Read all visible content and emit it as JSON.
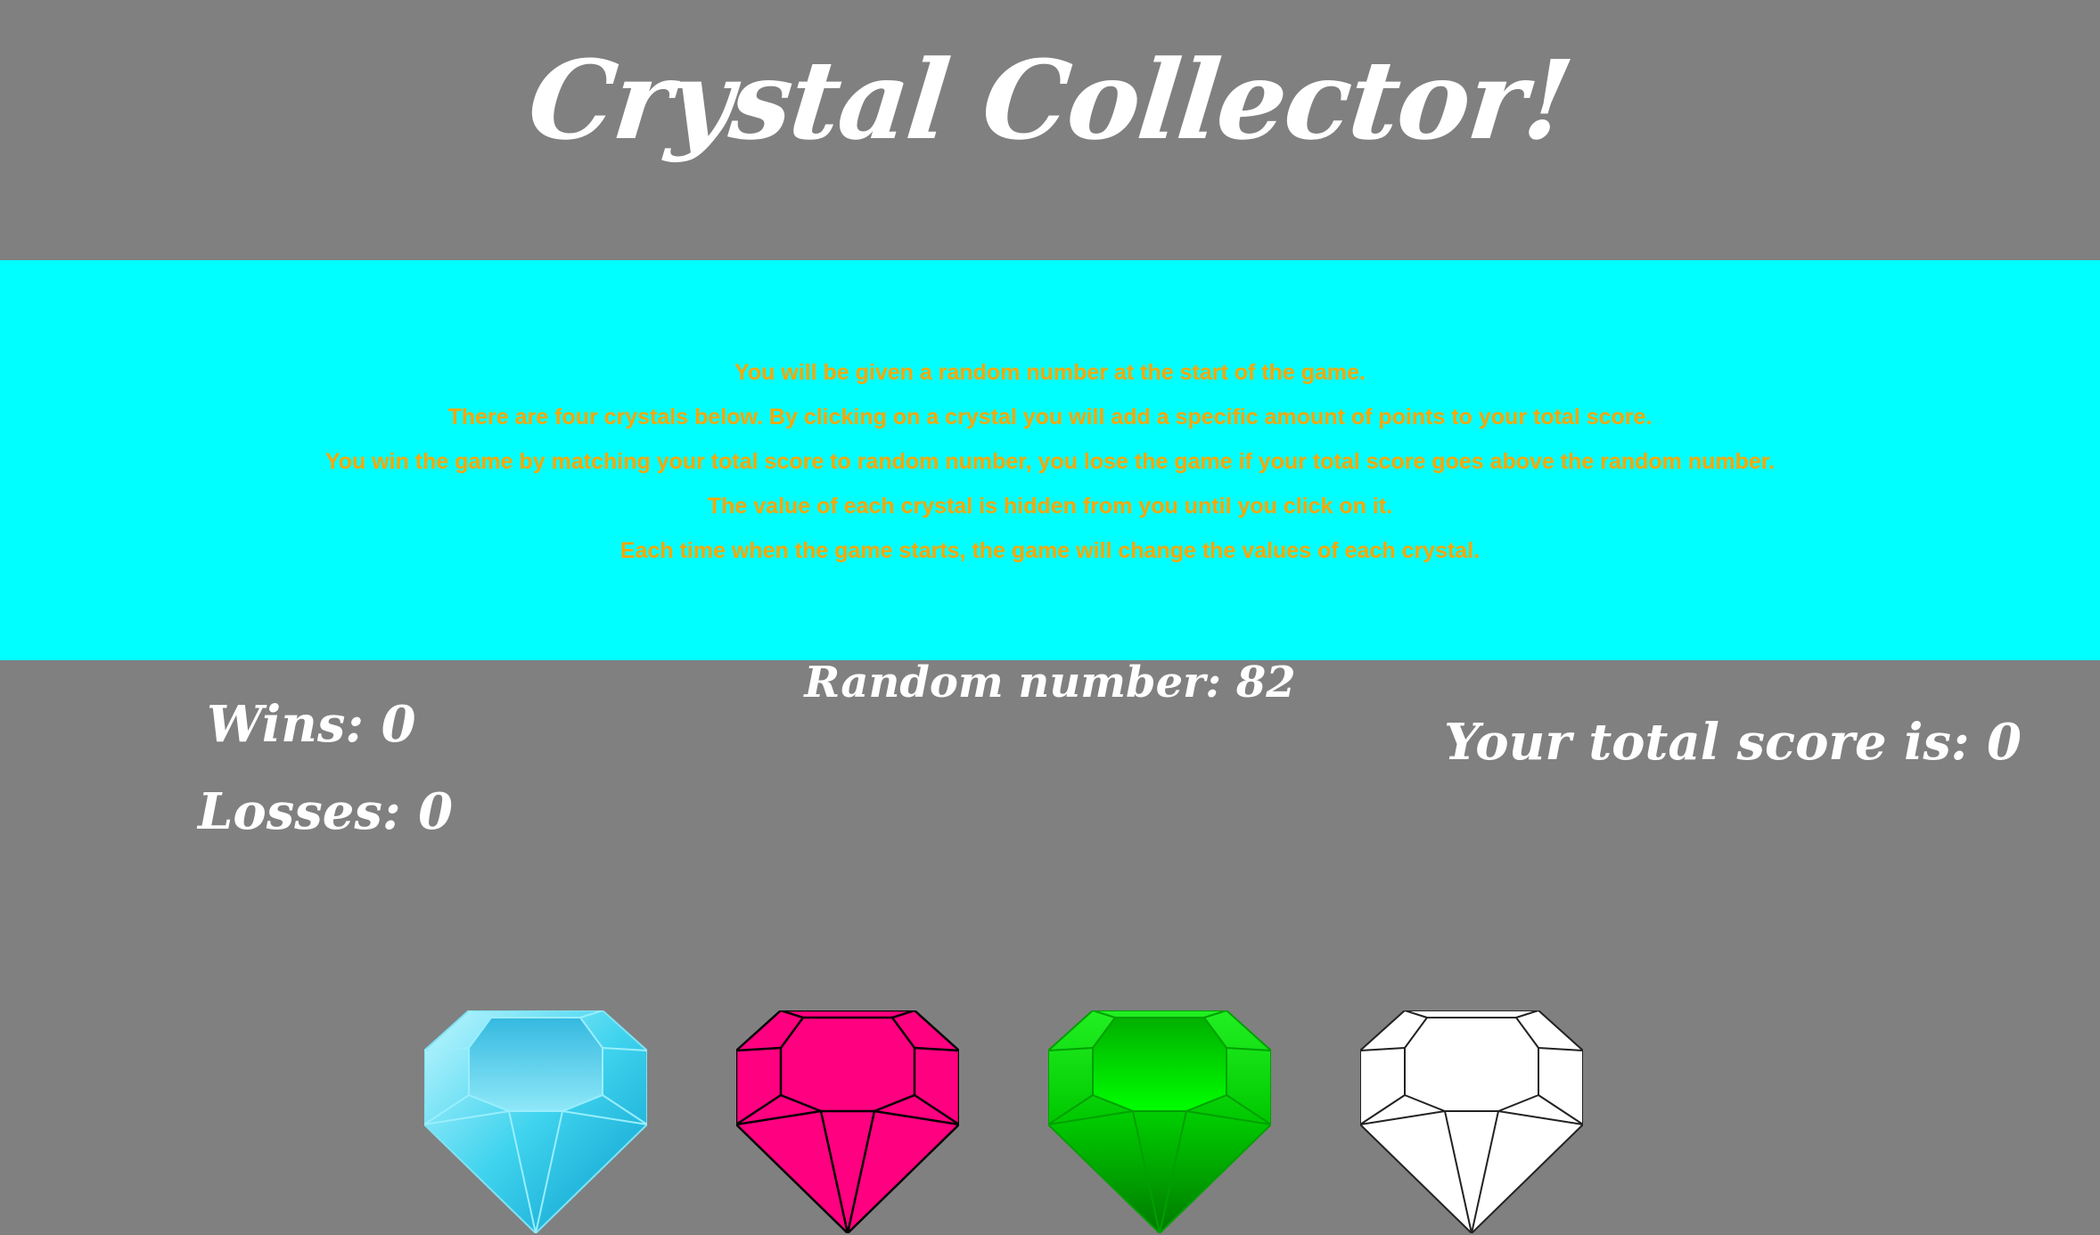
{
  "header": {
    "title": "Crystal Collector!"
  },
  "instructions": {
    "lines": [
      "You will be given a random number at the start of the game.",
      "There are four crystals below. By clicking on a crystal you will add a specific amount of points to your total score.",
      "You win the game by matching your total score to random number, you lose the game if your total score goes above the random number.",
      "The value of each crystal is hidden from you until you click on it.",
      "Each time when the game starts, the game will change the values of each crystal."
    ]
  },
  "game": {
    "random_label": "Random number: ",
    "random_value": "82",
    "wins_label": "Wins: ",
    "wins_value": "0",
    "losses_label": "Losses: ",
    "losses_value": "0",
    "score_label": "Your total score is: ",
    "score_value": "0"
  },
  "crystals": [
    {
      "name": "blue-crystal-icon",
      "color": "#3fd3ee"
    },
    {
      "name": "pink-crystal-icon",
      "color": "#ff0080"
    },
    {
      "name": "green-crystal-icon",
      "color": "#00d800"
    },
    {
      "name": "white-crystal-icon",
      "color": "#ffffff"
    }
  ],
  "colors": {
    "background": "#808080",
    "banner": "#00ffff",
    "instructions_text": "#ffa500",
    "heading_text": "#ffffff"
  }
}
